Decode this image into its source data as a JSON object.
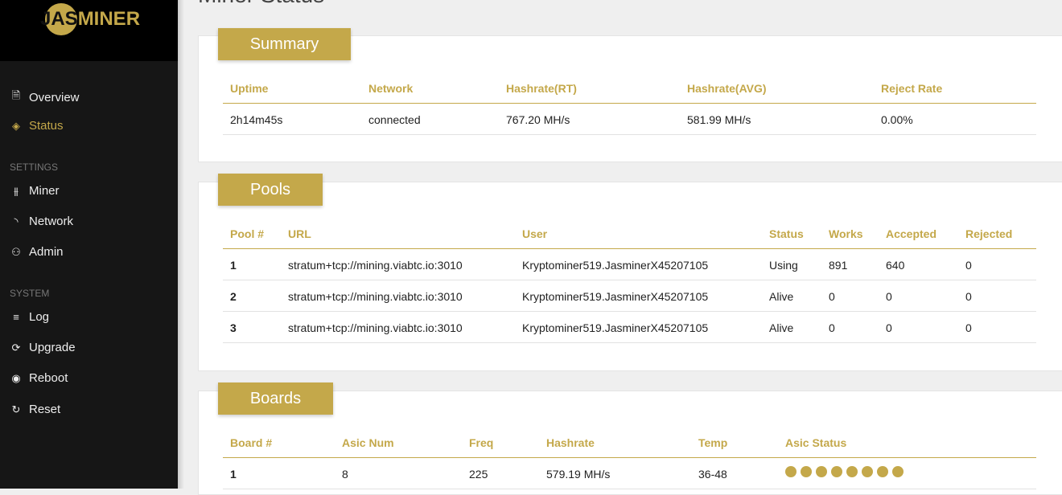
{
  "brand": "JASMINER",
  "page_title": "Miner Status",
  "sidebar": {
    "items": [
      {
        "label": "Overview",
        "icon": "document-icon"
      },
      {
        "label": "Status",
        "icon": "layers-icon",
        "active": true
      }
    ],
    "settings_label": "SETTINGS",
    "settings": [
      {
        "label": "Miner",
        "icon": "sliders-icon"
      },
      {
        "label": "Network",
        "icon": "rss-icon"
      },
      {
        "label": "Admin",
        "icon": "users-icon"
      }
    ],
    "system_label": "SYSTEM",
    "system": [
      {
        "label": "Log",
        "icon": "lines-icon"
      },
      {
        "label": "Upgrade",
        "icon": "refresh-icon"
      },
      {
        "label": "Reboot",
        "icon": "broadcast-icon"
      },
      {
        "label": "Reset",
        "icon": "rotate-icon"
      }
    ]
  },
  "summary": {
    "title": "Summary",
    "headers": [
      "Uptime",
      "Network",
      "Hashrate(RT)",
      "Hashrate(AVG)",
      "Reject Rate"
    ],
    "values": [
      "2h14m45s",
      "connected",
      "767.20 MH/s",
      "581.99 MH/s",
      "0.00%"
    ]
  },
  "pools": {
    "title": "Pools",
    "headers": [
      "Pool #",
      "URL",
      "User",
      "Status",
      "Works",
      "Accepted",
      "Rejected"
    ],
    "rows": [
      [
        "1",
        "stratum+tcp://mining.viabtc.io:3010",
        "Kryptominer519.JasminerX45207105",
        "Using",
        "891",
        "640",
        "0"
      ],
      [
        "2",
        "stratum+tcp://mining.viabtc.io:3010",
        "Kryptominer519.JasminerX45207105",
        "Alive",
        "0",
        "0",
        "0"
      ],
      [
        "3",
        "stratum+tcp://mining.viabtc.io:3010",
        "Kryptominer519.JasminerX45207105",
        "Alive",
        "0",
        "0",
        "0"
      ]
    ]
  },
  "boards": {
    "title": "Boards",
    "headers": [
      "Board #",
      "Asic Num",
      "Freq",
      "Hashrate",
      "Temp",
      "Asic Status"
    ],
    "rows": [
      {
        "cells": [
          "1",
          "8",
          "225",
          "579.19 MH/s",
          "36-48"
        ],
        "asic_ok": 8
      }
    ]
  },
  "accent_color": "#c4a84a"
}
